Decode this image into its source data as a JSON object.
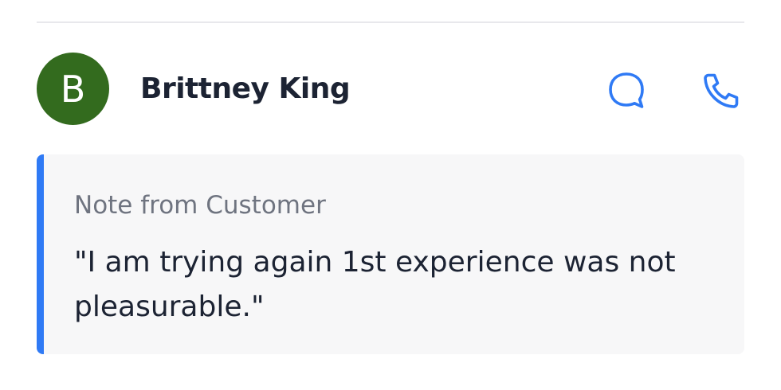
{
  "contact": {
    "avatar_initial": "B",
    "avatar_color": "#336b1e",
    "name": "Brittney King",
    "actions": {
      "chat_icon": "chat-bubble-icon",
      "call_icon": "phone-icon",
      "accent_color": "#2f7af5"
    }
  },
  "note": {
    "title": "Note from Customer",
    "text": "\"I am trying again 1st experience was not pleasurable.\"",
    "accent_color": "#2f7af5"
  }
}
